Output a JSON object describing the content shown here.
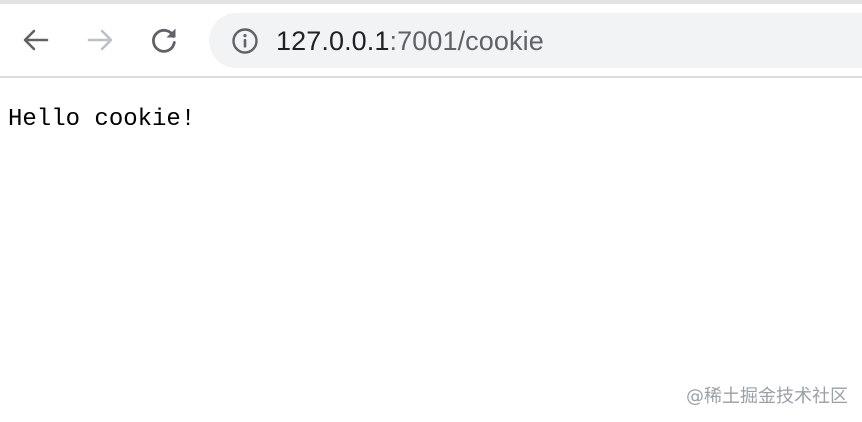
{
  "browser": {
    "url_host": "127.0.0.1",
    "url_path": ":7001/cookie",
    "icons": {
      "back": "back-arrow-icon",
      "forward": "forward-arrow-icon",
      "reload": "reload-icon",
      "site_info": "info-icon"
    },
    "colors": {
      "toolbar_bg": "#ffffff",
      "omnibox_bg": "#f1f3f4",
      "icon_active": "#5f6368",
      "icon_disabled": "#bdc1c6"
    }
  },
  "page": {
    "body_text": "Hello cookie!"
  },
  "watermark": {
    "text": "@稀土掘金技术社区"
  }
}
